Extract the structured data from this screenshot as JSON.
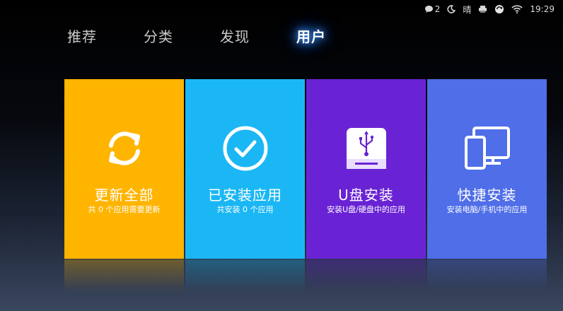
{
  "status_bar": {
    "message_count": "2",
    "weather": "晴",
    "time": "19:29"
  },
  "tabs": [
    {
      "label": "推荐",
      "active": false
    },
    {
      "label": "分类",
      "active": false
    },
    {
      "label": "发现",
      "active": false
    },
    {
      "label": "用户",
      "active": true
    }
  ],
  "cards": [
    {
      "title": "更新全部",
      "subtitle": "共 0 个应用需要更新",
      "color": "#ffb400",
      "icon": "refresh-icon"
    },
    {
      "title": "已安装应用",
      "subtitle": "共安装 0 个应用",
      "color": "#1bb7f5",
      "icon": "check-circle-icon"
    },
    {
      "title": "U盘安装",
      "subtitle": "安装U盘/硬盘中的应用",
      "color": "#6a23d4",
      "icon": "usb-drive-icon"
    },
    {
      "title": "快捷安装",
      "subtitle": "安装电脑/手机中的应用",
      "color": "#4f6ee8",
      "icon": "devices-icon"
    }
  ]
}
